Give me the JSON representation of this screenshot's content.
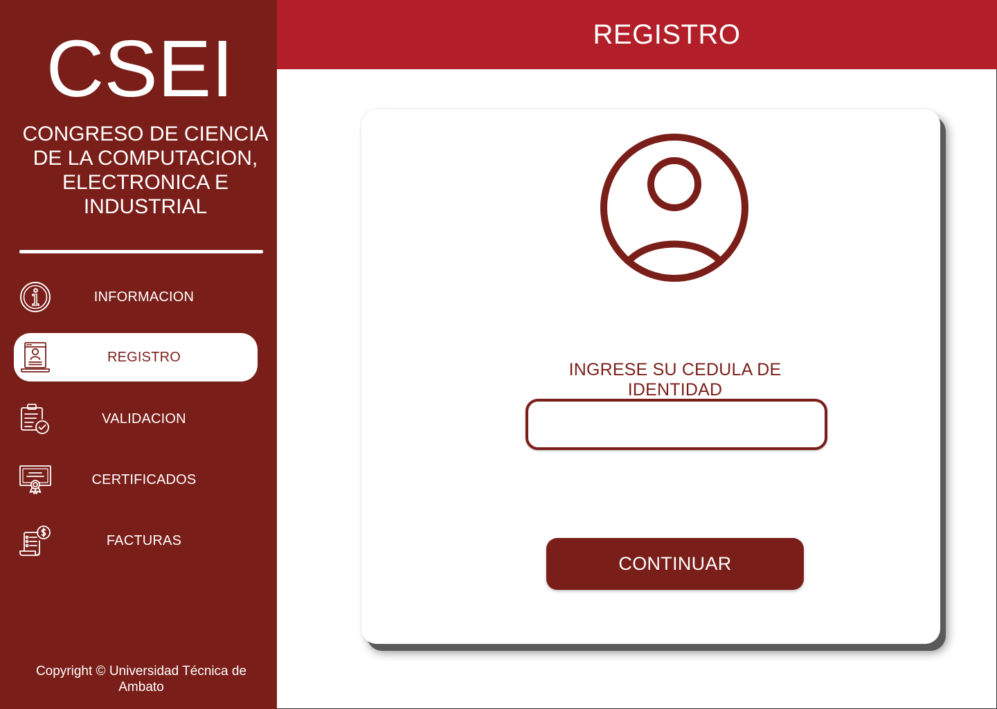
{
  "sidebar": {
    "logo": "CSEI",
    "subtitle": "CONGRESO DE CIENCIA DE LA COMPUTACION, ELECTRONICA E INDUSTRIAL",
    "items": [
      {
        "label": "INFORMACION",
        "icon": "info-icon"
      },
      {
        "label": "REGISTRO",
        "icon": "registration-icon",
        "active": true
      },
      {
        "label": "VALIDACION",
        "icon": "clipboard-check-icon"
      },
      {
        "label": "CERTIFICADOS",
        "icon": "certificate-icon"
      },
      {
        "label": "FACTURAS",
        "icon": "invoice-icon"
      }
    ],
    "copyright": "Copyright © Universidad Técnica de Ambato"
  },
  "header": {
    "title": "REGISTRO"
  },
  "form": {
    "avatar_icon": "user-avatar-icon",
    "label": "INGRESE SU CEDULA DE IDENTIDAD",
    "input_value": "",
    "input_placeholder": "",
    "button_label": "CONTINUAR"
  },
  "colors": {
    "sidebar_bg": "#7a1e19",
    "header_bg": "#b31f29",
    "accent": "#7a1e19",
    "text_light": "#ffffff"
  }
}
